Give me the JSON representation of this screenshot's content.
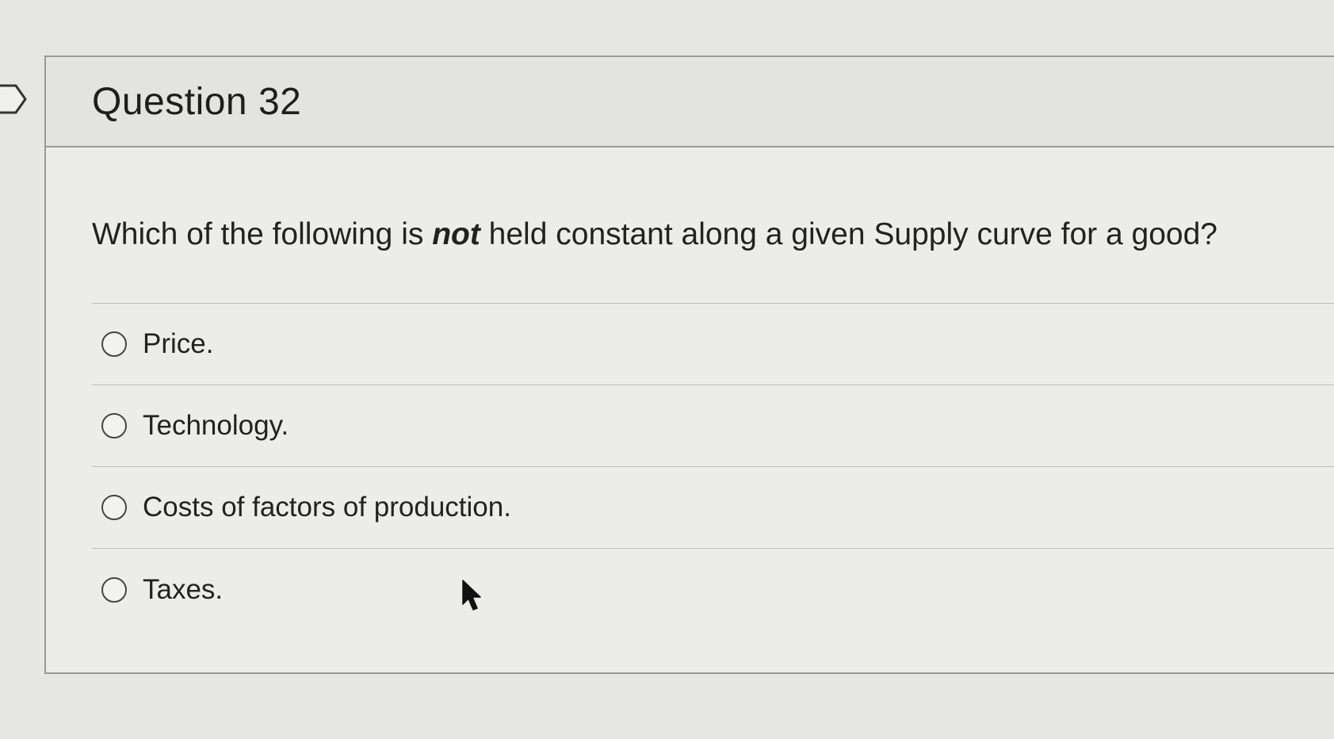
{
  "question": {
    "title": "Question 32",
    "text_before": "Which of the following is ",
    "text_emphasis": "not",
    "text_after": " held constant along a given Supply curve for a good?"
  },
  "answers": [
    {
      "label": "Price.",
      "selected": false
    },
    {
      "label": "Technology.",
      "selected": false
    },
    {
      "label": "Costs of factors of production.",
      "selected": false
    },
    {
      "label": "Taxes.",
      "selected": false
    }
  ],
  "icons": {
    "flag": "flag-marker-icon",
    "radio": "radio-empty-icon",
    "cursor": "mouse-pointer-icon"
  },
  "colors": {
    "page_background": "#e6e6e4",
    "card_background": "#ececea",
    "header_background": "#e3e3e1",
    "border": "#9a9a98"
  }
}
